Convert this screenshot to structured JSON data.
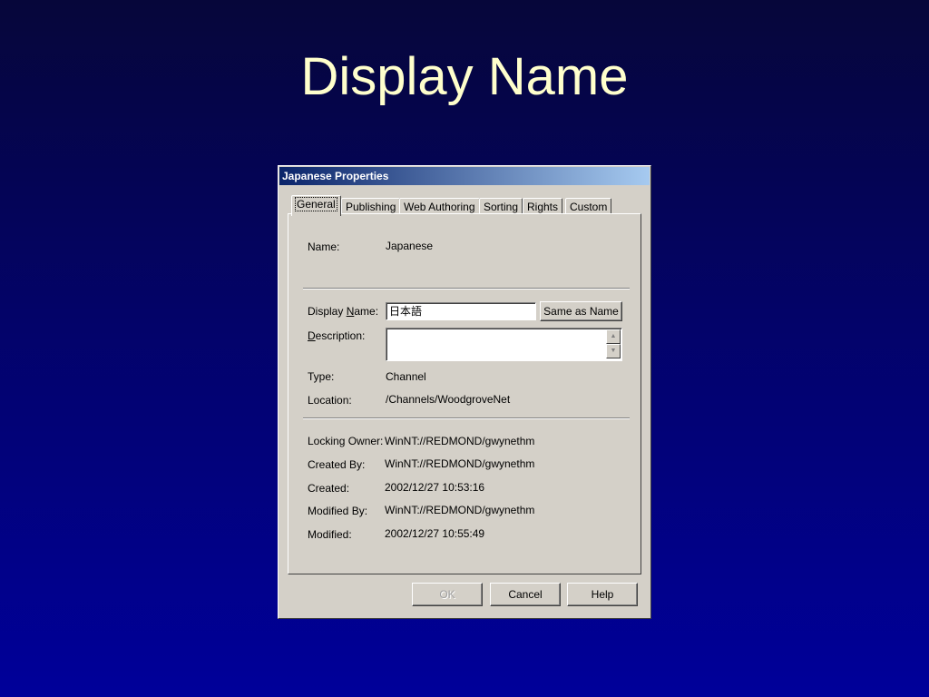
{
  "slide": {
    "title": "Display Name"
  },
  "dialog": {
    "title": "Japanese Properties",
    "tabs": [
      "General",
      "Publishing",
      "Web Authoring",
      "Sorting",
      "Rights",
      "Custom"
    ],
    "active_tab": "General",
    "fields": {
      "name_label": "Name:",
      "name_value": "Japanese",
      "display_name_label_pre": "Display ",
      "display_name_label_key": "N",
      "display_name_label_post": "ame:",
      "display_name_value": "日本語",
      "same_as_name_button": "Same as Name",
      "description_label_key": "D",
      "description_label_post": "escription:",
      "description_value": "",
      "type_label": "Type:",
      "type_value": "Channel",
      "location_label": "Location:",
      "location_value": "/Channels/WoodgroveNet",
      "locking_owner_label": "Locking Owner:",
      "locking_owner_value": "WinNT://REDMOND/gwynethm",
      "created_by_label": "Created By:",
      "created_by_value": "WinNT://REDMOND/gwynethm",
      "created_label": "Created:",
      "created_value": "2002/12/27 10:53:16",
      "modified_by_label": "Modified By:",
      "modified_by_value": "WinNT://REDMOND/gwynethm",
      "modified_label": "Modified:",
      "modified_value": "2002/12/27 10:55:49"
    },
    "buttons": {
      "ok": "OK",
      "cancel": "Cancel",
      "help": "Help"
    },
    "icons": {
      "scroll_up": "scroll-up-arrow-icon",
      "scroll_down": "scroll-down-arrow-icon"
    }
  }
}
